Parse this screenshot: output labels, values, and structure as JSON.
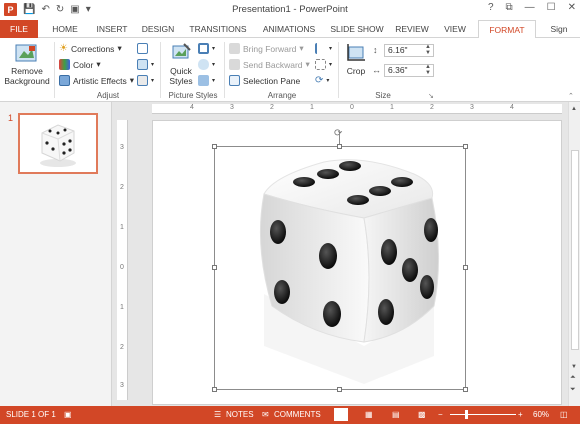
{
  "window": {
    "title": "Presentation1 - PowerPoint",
    "controls": [
      "?",
      "⧉",
      "—",
      "☐",
      "✕"
    ]
  },
  "qat": {
    "logo": "P",
    "save_icon": "save-icon",
    "undo_icon": "undo-icon",
    "redo_icon": "redo-icon",
    "present_icon": "present-icon",
    "more": "▾"
  },
  "tabs": [
    {
      "label": "FILE"
    },
    {
      "label": "HOME"
    },
    {
      "label": "INSERT"
    },
    {
      "label": "DESIGN"
    },
    {
      "label": "TRANSITIONS"
    },
    {
      "label": "ANIMATIONS"
    },
    {
      "label": "SLIDE SHOW"
    },
    {
      "label": "REVIEW"
    },
    {
      "label": "VIEW"
    },
    {
      "label": "FORMAT"
    },
    {
      "label": "Sign"
    }
  ],
  "ribbon": {
    "remove_background": "Remove Background",
    "corrections": "Corrections",
    "color": "Color",
    "artistic_effects": "Artistic Effects",
    "quick_styles": "Quick Styles",
    "bring_forward": "Bring Forward",
    "send_backward": "Send Backward",
    "selection_pane": "Selection Pane",
    "crop": "Crop",
    "height": "6.16\"",
    "width": "6.36\"",
    "groups": {
      "adjust": "Adjust",
      "picture_styles": "Picture Styles",
      "arrange": "Arrange",
      "size": "Size"
    }
  },
  "thumbnail": {
    "slide_number": "1"
  },
  "ruler": {
    "h": [
      "4",
      "3",
      "2",
      "1",
      "0",
      "1",
      "2",
      "3",
      "4"
    ],
    "v": [
      "3",
      "2",
      "1",
      "0",
      "1",
      "2",
      "3"
    ]
  },
  "status": {
    "slide_info": "SLIDE 1 OF 1",
    "notes": "NOTES",
    "comments": "COMMENTS",
    "zoom": "60%"
  },
  "colors": {
    "accent": "#d24726"
  }
}
